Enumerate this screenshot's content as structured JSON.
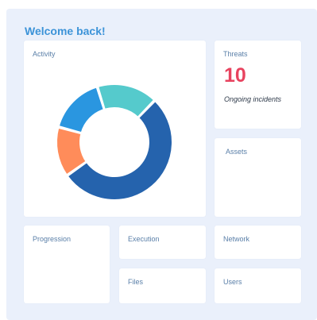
{
  "header": {
    "title": "Welcome back!"
  },
  "cards": {
    "activity": {
      "label": "Activity"
    },
    "threats": {
      "label": "Threats",
      "value": "10",
      "subtitle": "Ongoing incidents"
    },
    "assets": {
      "label": "Assets"
    },
    "progression": {
      "label": "Progression"
    },
    "execution": {
      "label": "Execution"
    },
    "network": {
      "label": "Network"
    },
    "files": {
      "label": "Files"
    },
    "users": {
      "label": "Users"
    }
  },
  "colors": {
    "accent": "#3c93d8",
    "threat_value": "#e8435f",
    "panel_background": "#eaf0fb"
  },
  "chart_data": {
    "type": "pie",
    "title": "",
    "series": [
      {
        "values": [
          53,
          14,
          16,
          17
        ],
        "colors": [
          "#2563ad",
          "#ff8c5a",
          "#2a96e0",
          "#55cacc"
        ]
      }
    ]
  }
}
